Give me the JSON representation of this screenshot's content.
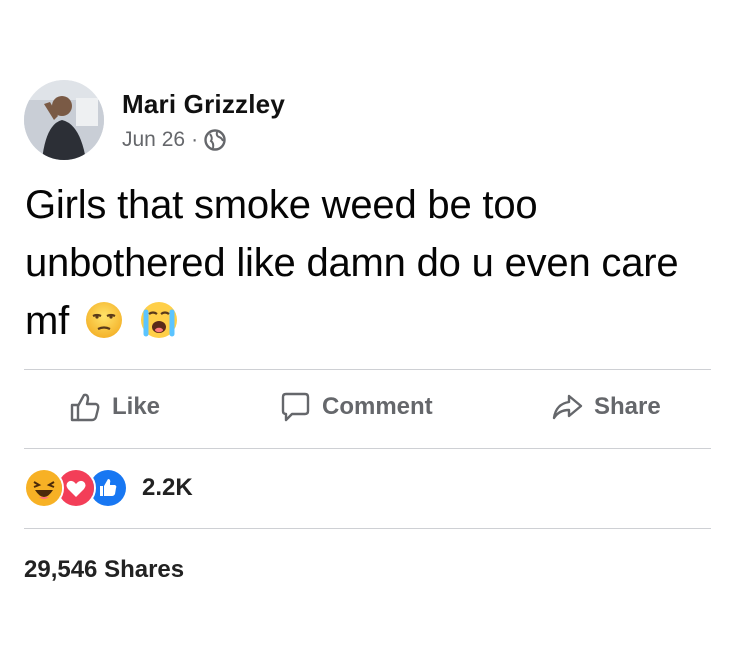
{
  "post": {
    "author": "Mari Grizzley",
    "date": "Jun 26",
    "separator": "·",
    "privacy_icon": "globe-icon",
    "text": "Girls that smoke weed be too unbothered like damn do u even care mf",
    "emojis": [
      "unamused-face",
      "loudly-crying-face"
    ]
  },
  "actions": {
    "like_label": "Like",
    "comment_label": "Comment",
    "share_label": "Share"
  },
  "stats": {
    "reaction_icons": [
      "haha-reaction-icon",
      "love-reaction-icon",
      "like-reaction-icon"
    ],
    "reaction_count": "2.2K",
    "shares_text": "29,546 Shares"
  },
  "colors": {
    "text": "#050505",
    "muted": "#65676b",
    "divider": "#ced0d4",
    "like_blue": "#1877f2",
    "love_red": "#f33e58",
    "haha_yellow": "#f7b125"
  }
}
